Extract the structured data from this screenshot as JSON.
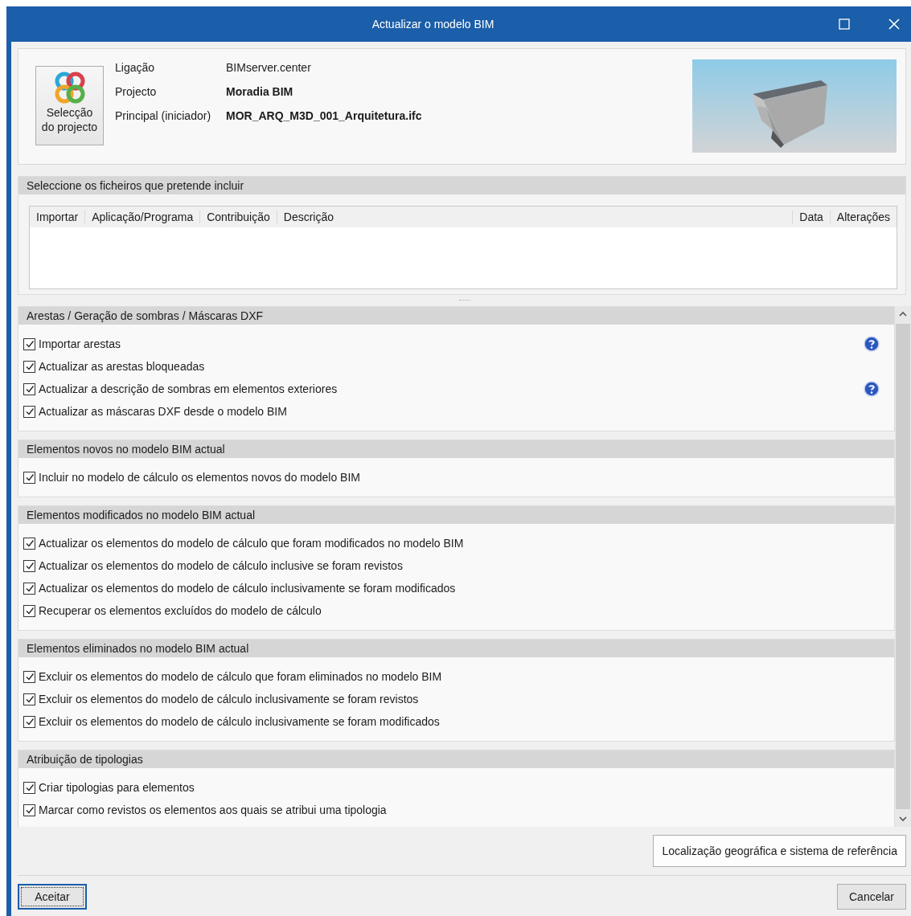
{
  "window": {
    "title": "Actualizar o modelo BIM"
  },
  "project": {
    "button": [
      "Selecção",
      "do projecto"
    ],
    "fields": [
      {
        "label": "Ligação",
        "value": "BIMserver.center",
        "bold": false
      },
      {
        "label": "Projecto",
        "value": "Moradia BIM",
        "bold": true
      },
      {
        "label": "Principal (iniciador)",
        "value": "MOR_ARQ_M3D_001_Arquitetura.ifc",
        "bold": true
      }
    ],
    "thumbnail": {
      "kind": "picture"
    }
  },
  "files": {
    "title": "Seleccione os ficheiros que pretende incluir",
    "columns": [
      "Importar",
      "Aplicação/Programa",
      "Contribuição",
      "Descrição",
      "Data",
      "Alterações"
    ]
  },
  "sections": [
    {
      "title": "Arestas / Geração de sombras / Máscaras DXF",
      "options": [
        {
          "label": "Importar arestas",
          "checked": true,
          "help": true
        },
        {
          "label": "Actualizar as arestas bloqueadas",
          "checked": true,
          "help": false
        },
        {
          "label": "Actualizar a descrição de sombras em elementos exteriores",
          "checked": true,
          "help": true
        },
        {
          "label": "Actualizar as máscaras DXF desde o modelo BIM",
          "checked": true,
          "help": false
        }
      ]
    },
    {
      "title": "Elementos novos no modelo BIM actual",
      "options": [
        {
          "label": "Incluir no modelo de cálculo os elementos novos do modelo BIM",
          "checked": true,
          "help": false
        }
      ]
    },
    {
      "title": "Elementos modificados no modelo BIM actual",
      "options": [
        {
          "label": "Actualizar os elementos do modelo de cálculo que foram modificados no modelo BIM",
          "checked": true,
          "help": false
        },
        {
          "label": "Actualizar os elementos do modelo de cálculo inclusive se foram revistos",
          "checked": true,
          "help": false
        },
        {
          "label": "Actualizar os elementos do modelo de cálculo inclusivamente se foram modificados",
          "checked": true,
          "help": false
        },
        {
          "label": "Recuperar os elementos excluídos do modelo de cálculo",
          "checked": true,
          "help": false
        }
      ]
    },
    {
      "title": "Elementos eliminados no modelo BIM actual",
      "options": [
        {
          "label": "Excluir os elementos do modelo de cálculo que foram eliminados no modelo BIM",
          "checked": true,
          "help": false
        },
        {
          "label": "Excluir os elementos do modelo de cálculo inclusivamente se foram revistos",
          "checked": true,
          "help": false
        },
        {
          "label": "Excluir os elementos do modelo de cálculo inclusivamente se foram modificados",
          "checked": true,
          "help": false
        }
      ]
    },
    {
      "title": "Atribuição de tipologias",
      "options": [
        {
          "label": "Criar tipologias para elementos",
          "checked": true,
          "help": false
        },
        {
          "label": "Marcar como revistos os elementos aos quais se atribui uma tipologia",
          "checked": true,
          "help": false
        }
      ]
    }
  ],
  "geo_button": "Localização geográfica e sistema de referência",
  "buttons": [
    "Aceitar",
    "Cancelar"
  ]
}
